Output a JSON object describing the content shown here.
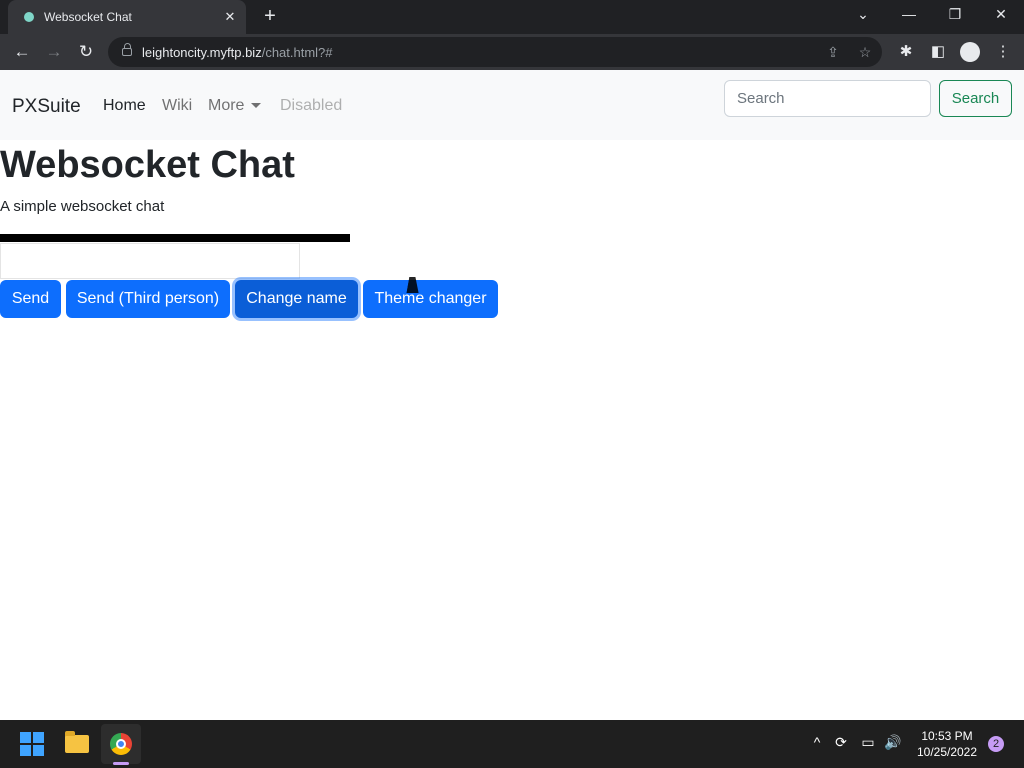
{
  "browser": {
    "tab_title": "Websocket Chat",
    "tab_close_glyph": "✕",
    "new_tab_glyph": "+",
    "url_host": "leightoncity.myftp.biz",
    "url_path": "/chat.html?#",
    "window_controls": {
      "tabs_dropdown": "⌄",
      "minimize": "—",
      "restore": "❐",
      "close": "✕"
    },
    "nav": {
      "back": "←",
      "forward": "→",
      "reload": "↻"
    },
    "toolbar_icons": {
      "share": "⇪",
      "bookmark": "☆",
      "extensions": "✱",
      "sidebar": "◧",
      "menu": "⋮"
    }
  },
  "navbar": {
    "brand": "PXSuite",
    "links": [
      {
        "label": "Home",
        "state": "active"
      },
      {
        "label": "Wiki",
        "state": "normal"
      },
      {
        "label": "More",
        "state": "dropdown"
      },
      {
        "label": "Disabled",
        "state": "disabled"
      }
    ],
    "search_placeholder": "Search",
    "search_button": "Search"
  },
  "main": {
    "title": "Websocket Chat",
    "subtitle": "A simple websocket chat",
    "chat_input_value": "",
    "buttons": [
      {
        "label": "Send"
      },
      {
        "label": "Send (Third person)"
      },
      {
        "label": "Change name",
        "focused": true
      },
      {
        "label": "Theme changer"
      }
    ]
  },
  "taskbar": {
    "tray": {
      "chevron": "^",
      "sync": "⟳",
      "network": "▭",
      "volume": "🔊"
    },
    "time": "10:53 PM",
    "date": "10/25/2022",
    "notification_count": "2"
  },
  "colors": {
    "primary": "#0d6efd",
    "success_outline": "#198754",
    "navbar_bg": "#f8f9fa",
    "browser_frame": "#202124",
    "taskbar_bg": "#1f1f1f"
  }
}
